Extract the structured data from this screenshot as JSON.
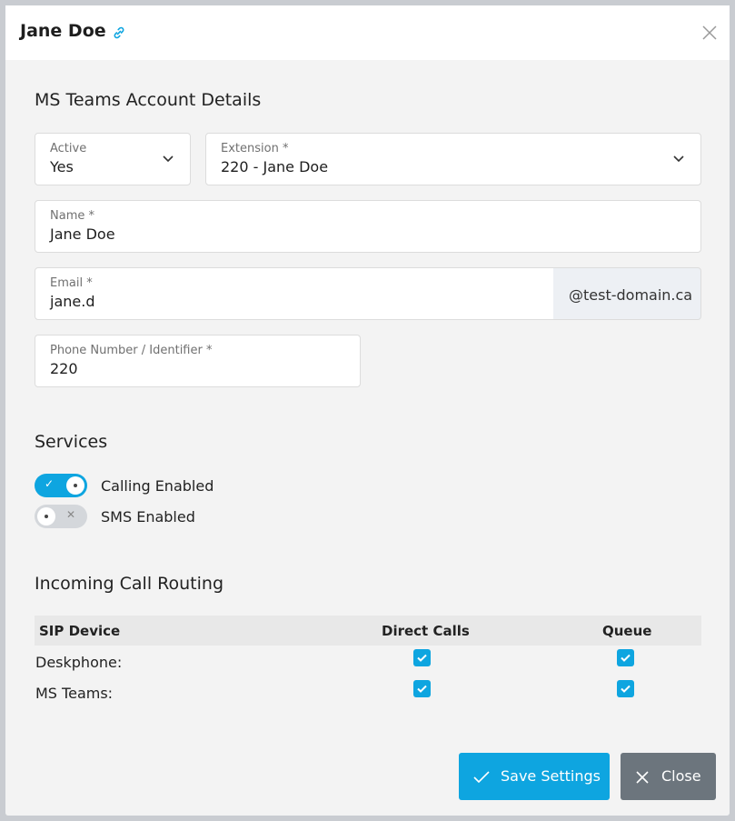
{
  "header": {
    "title": "Jane Doe"
  },
  "section_account": {
    "title": "MS Teams Account Details"
  },
  "fields": {
    "active": {
      "label": "Active",
      "value": "Yes"
    },
    "extension": {
      "label": "Extension *",
      "value": "220 - Jane Doe"
    },
    "name": {
      "label": "Name *",
      "value": "Jane Doe"
    },
    "email": {
      "label": "Email *",
      "value": "jane.d",
      "domain_suffix": "@test-domain.ca"
    },
    "phone": {
      "label": "Phone Number / Identifier *",
      "value": "220"
    }
  },
  "services": {
    "title": "Services",
    "calling": {
      "label": "Calling Enabled",
      "enabled": true
    },
    "sms": {
      "label": "SMS Enabled",
      "enabled": false
    }
  },
  "routing": {
    "title": "Incoming Call Routing",
    "columns": [
      "SIP Device",
      "Direct Calls",
      "Queue"
    ],
    "rows": [
      {
        "device": "Deskphone:",
        "direct_calls": true,
        "queue": true
      },
      {
        "device": "MS Teams:",
        "direct_calls": true,
        "queue": true
      }
    ]
  },
  "buttons": {
    "save": "Save Settings",
    "close": "Close"
  },
  "colors": {
    "accent": "#0ea5e0",
    "close_button": "#6c757d"
  }
}
